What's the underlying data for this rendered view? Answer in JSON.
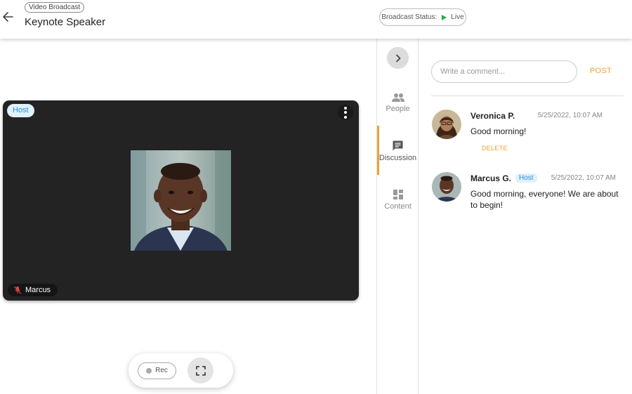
{
  "header": {
    "type_badge": "Video Broadcast",
    "title": "Keynote Speaker",
    "status_label": "Broadcast Status:",
    "status_value": "Live",
    "status_color": "#2ea84b"
  },
  "video": {
    "host_badge": "Host",
    "participant_name": "Marcus",
    "mic_state": "muted"
  },
  "controls": {
    "rec_label": "Rec"
  },
  "tabs": [
    {
      "label": "People",
      "icon": "people-icon"
    },
    {
      "label": "Discussion",
      "icon": "discussion-icon",
      "active": true
    },
    {
      "label": "Content",
      "icon": "content-icon"
    }
  ],
  "discussion": {
    "placeholder": "Write a comment...",
    "post_label": "POST",
    "comments": [
      {
        "name": "Veronica P.",
        "time": "5/25/2022, 10:07 AM",
        "text": "Good morning!",
        "action": "DELETE"
      },
      {
        "name": "Marcus G.",
        "badge": "Host",
        "time": "5/25/2022, 10:07 AM",
        "text": "Good morning, everyone! We are about to begin!"
      }
    ]
  },
  "colors": {
    "accent": "#f0a030",
    "host_badge_bg": "#e0f1fb",
    "host_badge_text": "#2a8fd6",
    "video_bg": "#232323"
  }
}
